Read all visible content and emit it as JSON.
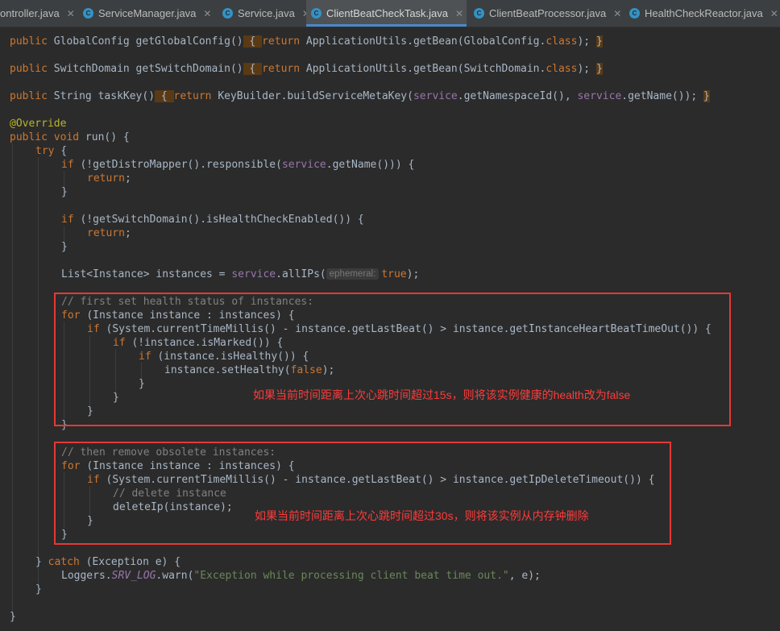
{
  "tabs": [
    {
      "label": "ontroller.java",
      "active": false
    },
    {
      "label": "ServiceManager.java",
      "active": false
    },
    {
      "label": "Service.java",
      "active": false
    },
    {
      "label": "ClientBeatCheckTask.java",
      "active": true
    },
    {
      "label": "ClientBeatProcessor.java",
      "active": false
    },
    {
      "label": "HealthCheckReactor.java",
      "active": false
    }
  ],
  "code": {
    "l1": {
      "a": "public ",
      "b": "GlobalConfig ",
      "c": "getGlobalConfig()",
      "d": " { ",
      "e": "return ",
      "f": "ApplicationUtils.",
      "g": "getBean(",
      "h": "GlobalConfig.",
      "i": "class",
      "j": "); ",
      "k": "}"
    },
    "l2": {
      "a": "public ",
      "b": "SwitchDomain ",
      "c": "getSwitchDomain()",
      "d": " { ",
      "e": "return ",
      "f": "ApplicationUtils.",
      "g": "getBean(",
      "h": "SwitchDomain.",
      "i": "class",
      "j": "); ",
      "k": "}"
    },
    "l3": {
      "a": "public ",
      "b": "String ",
      "c": "taskKey()",
      "d": " { ",
      "e": "return ",
      "f": "KeyBuilder.",
      "g": "buildServiceMetaKey(",
      "h": "service",
      "i": ".getNamespaceId(), ",
      "j": "service",
      "k": ".getName()); ",
      "l": "}"
    },
    "override": "@Override",
    "run": {
      "a": "public void ",
      "b": "run",
      "c": "() {"
    },
    "try": {
      "a": "try",
      "b": " {"
    },
    "if1": {
      "a": "if ",
      "b": "(!getDistroMapper().",
      "c": "responsible(",
      "d": "service",
      "e": ".getName())) {"
    },
    "ret1": {
      "a": "return",
      "b": ";"
    },
    "close1": "}",
    "if2": {
      "a": "if ",
      "b": "(!getSwitchDomain().",
      "c": "isHealthCheckEnabled()) {"
    },
    "ret2": {
      "a": "return",
      "b": ";"
    },
    "close2": "}",
    "list": {
      "a": "List<",
      "b": "Instance",
      "c": "> instances = ",
      "d": "service",
      "e": ".allIPs(",
      "hint": "ephemeral:",
      "f": "true",
      "g": ");"
    },
    "cmt1": "// first set health status of instances:",
    "for1": {
      "a": "for ",
      "b": "(",
      "c": "Instance",
      "d": " instance : instances) {"
    },
    "if3": {
      "a": "if ",
      "b": "(",
      "c": "System",
      "d": ".currentTimeMillis() - instance.",
      "e": "getLastBeat",
      "f": "() > instance.",
      "g": "getInstanceHeartBeatTimeOut",
      "h": "()) {"
    },
    "if4": {
      "a": "if ",
      "b": "(!instance.",
      "c": "isMarked",
      "d": "()) {"
    },
    "if5": {
      "a": "if ",
      "b": "(instance.",
      "c": "isHealthy",
      "d": "()) {"
    },
    "set": {
      "a": "instance.",
      "b": "setHealthy",
      "c": "(",
      "d": "false",
      "e": ");"
    },
    "cl5": "}",
    "cl4": "}",
    "cl3": "}",
    "cl_for1": "}",
    "cmt2": "// then remove obsolete instances:",
    "for2": {
      "a": "for ",
      "b": "(",
      "c": "Instance",
      "d": " instance : instances) {"
    },
    "if6": {
      "a": "if ",
      "b": "(",
      "c": "System",
      "d": ".currentTimeMillis() - instance.",
      "e": "getLastBeat",
      "f": "() > instance.",
      "g": "getIpDeleteTimeout",
      "h": "()) {"
    },
    "cmt3": "// delete instance",
    "del": {
      "a": "deleteIp",
      "b": "(instance);"
    },
    "cl6": "}",
    "cl_for2": "}",
    "catch": {
      "a": "} ",
      "b": "catch ",
      "c": "(",
      "d": "Exception",
      "e": " e) {"
    },
    "log": {
      "a": "Loggers.",
      "b": "SRV_LOG",
      "c": ".",
      "d": "warn",
      "e": "(",
      "f": "\"Exception while processing client beat time out.\"",
      "g": ", e);"
    },
    "cl_catch": "}",
    "cl_run": "}"
  },
  "annotations": {
    "note1": "如果当前时间距离上次心跳时间超过15s，则将该实例健康的health改为false",
    "note2": "如果当前时间距离上次心跳时间超过30s，则将该实例从内存钟删除"
  },
  "colors": {
    "annotation_red": "#e53935",
    "active_tab_underline": "#4a88c7"
  }
}
